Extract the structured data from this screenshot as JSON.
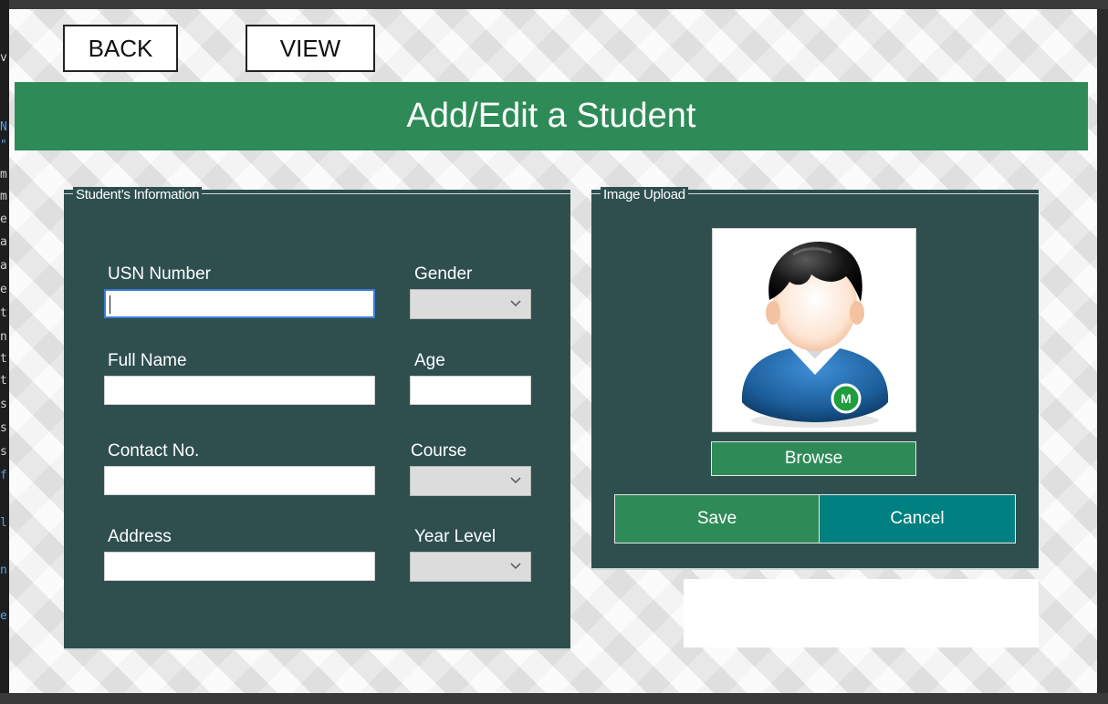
{
  "window": {
    "back_label": "BACK",
    "view_label": "VIEW",
    "title": "Add/Edit a Student"
  },
  "student_info": {
    "legend": "Student’s Information",
    "usn": {
      "label": "USN Number",
      "value": ""
    },
    "gender": {
      "label": "Gender",
      "value": ""
    },
    "full_name": {
      "label": "Full Name",
      "value": ""
    },
    "age": {
      "label": "Age",
      "value": ""
    },
    "contact": {
      "label": "Contact No.",
      "value": ""
    },
    "course": {
      "label": "Course",
      "value": ""
    },
    "address": {
      "label": "Address",
      "value": ""
    },
    "year_level": {
      "label": "Year Level",
      "value": ""
    }
  },
  "image_upload": {
    "legend": "Image Upload",
    "browse_label": "Browse",
    "save_label": "Save",
    "cancel_label": "Cancel",
    "avatar_badge": "M",
    "avatar_icon": "student-avatar-icon"
  },
  "editor_strip": [
    "v",
    "N",
    "\"",
    "m",
    "m",
    "e",
    "a",
    "a",
    "e",
    "t",
    "n",
    "t",
    "t",
    "s",
    "s",
    "s",
    "f",
    "l",
    "n",
    "e"
  ],
  "colors": {
    "accent_green": "#2e8b57",
    "panel": "#2f4f4f",
    "cancel_teal": "#008080"
  }
}
